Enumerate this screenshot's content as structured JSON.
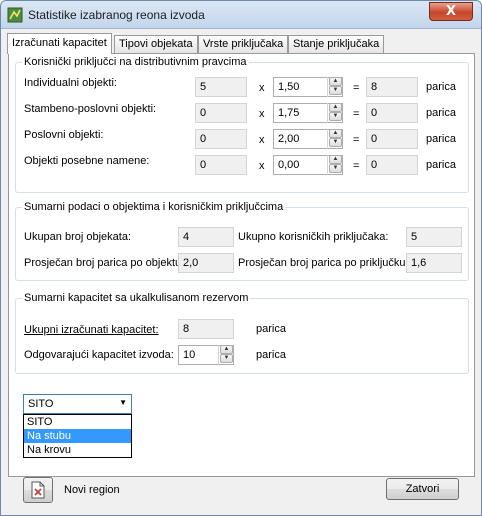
{
  "window": {
    "title": "Statistike izabranog reona izvoda",
    "close_label": "X"
  },
  "tabs": [
    {
      "label": "Izračunati kapacitet",
      "active": true
    },
    {
      "label": "Tipovi objekata",
      "active": false
    },
    {
      "label": "Vrste priključaka",
      "active": false
    },
    {
      "label": "Stanje priključaka",
      "active": false
    }
  ],
  "group1": {
    "title": "Korisnički priključci na distributivnim pravcima",
    "multiply_sign": "x",
    "equals_sign": "=",
    "unit": "parica",
    "rows": [
      {
        "label": "Individualni objekti:",
        "count": "5",
        "factor": "1,50",
        "result": "8"
      },
      {
        "label": "Stambeno-poslovni objekti:",
        "count": "0",
        "factor": "1,75",
        "result": "0"
      },
      {
        "label": "Poslovni objekti:",
        "count": "0",
        "factor": "2,00",
        "result": "0"
      },
      {
        "label": "Objekti posebne namene:",
        "count": "0",
        "factor": "0,00",
        "result": "0"
      }
    ]
  },
  "group2": {
    "title": "Sumarni podaci o objektima i korisničkim priključcima",
    "total_objects_label": "Ukupan broj objekata:",
    "total_objects_value": "4",
    "total_connections_label": "Ukupno korisničkih priključaka:",
    "total_connections_value": "5",
    "avg_pairs_object_label": "Prosječan broj parica po objektu:",
    "avg_pairs_object_value": "2,0",
    "avg_pairs_connection_label": "Prosječan broj parica po priključku:",
    "avg_pairs_connection_value": "1,6"
  },
  "group3": {
    "title": "Sumarni kapacitet sa ukalkulisanom rezervom",
    "computed_label": "Ukupni izračunati kapacitet:",
    "computed_value": "8",
    "unit": "parica",
    "matching_label": "Odgovarajući kapacitet izvoda:",
    "matching_value": "10"
  },
  "type_select": {
    "value": "SITO",
    "options": [
      "SITO",
      "Na stubu",
      "Na krovu"
    ],
    "highlighted": "Na stubu"
  },
  "footer": {
    "new_region_label": "Novi region",
    "close_label": "Zatvori"
  },
  "colors": {
    "highlight": "#3399ff",
    "titlebar": "#c3d5ec",
    "close": "#c7462b"
  }
}
